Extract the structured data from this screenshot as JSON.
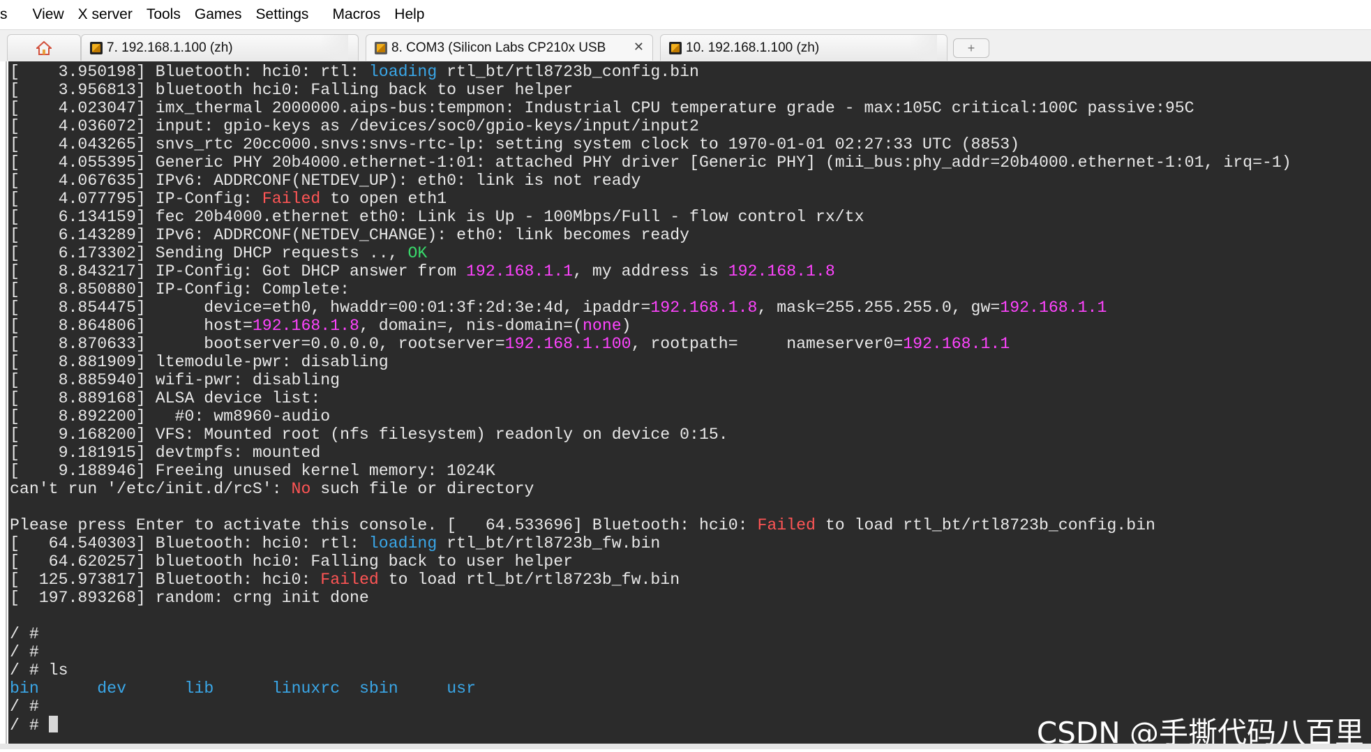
{
  "menu": {
    "items": [
      "s",
      "View",
      "X server",
      "Tools",
      "Games",
      "Settings",
      "Macros",
      "Help"
    ]
  },
  "tabs": {
    "home_icon": "home-icon",
    "items": [
      {
        "label": "7. 192.168.1.100 (zh)",
        "icon": "terminal-icon"
      },
      {
        "label": "8. COM3  (Silicon Labs CP210x USB",
        "icon": "serial-icon",
        "close": "✕"
      },
      {
        "label": "10. 192.168.1.100 (zh)",
        "icon": "terminal-icon"
      }
    ],
    "new_tab_symbol": "+"
  },
  "terminal": {
    "lines": [
      [
        {
          "t": "[    3.950198] Bluetooth: hci0: rtl: "
        },
        {
          "t": "loading",
          "c": "blue"
        },
        {
          "t": " rtl_bt/rtl8723b_config.bin"
        }
      ],
      [
        {
          "t": "[    3.956813] bluetooth hci0: Falling back to user helper"
        }
      ],
      [
        {
          "t": "[    4.023047] imx_thermal 2000000.aips-bus:tempmon: Industrial CPU temperature grade - max:105C critical:100C passive:95C"
        }
      ],
      [
        {
          "t": "[    4.036072] input: gpio-keys as /devices/soc0/gpio-keys/input/input2"
        }
      ],
      [
        {
          "t": "[    4.043265] snvs_rtc 20cc000.snvs:snvs-rtc-lp: setting system clock to 1970-01-01 02:27:33 UTC (8853)"
        }
      ],
      [
        {
          "t": "[    4.055395] Generic PHY 20b4000.ethernet-1:01: attached PHY driver [Generic PHY] (mii_bus:phy_addr=20b4000.ethernet-1:01, irq=-1)"
        }
      ],
      [
        {
          "t": "[    4.067635] IPv6: ADDRCONF(NETDEV_UP): eth0: link is not ready"
        }
      ],
      [
        {
          "t": "[    4.077795] IP-Config: "
        },
        {
          "t": "Failed",
          "c": "red"
        },
        {
          "t": " to open eth1"
        }
      ],
      [
        {
          "t": "[    6.134159] fec 20b4000.ethernet eth0: Link is Up - 100Mbps/Full - flow control rx/tx"
        }
      ],
      [
        {
          "t": "[    6.143289] IPv6: ADDRCONF(NETDEV_CHANGE): eth0: link becomes ready"
        }
      ],
      [
        {
          "t": "[    6.173302] Sending DHCP requests .., "
        },
        {
          "t": "OK",
          "c": "green"
        }
      ],
      [
        {
          "t": "[    8.843217] IP-Config: Got DHCP answer from "
        },
        {
          "t": "192.168.1.1",
          "c": "mag"
        },
        {
          "t": ", my address is "
        },
        {
          "t": "192.168.1.8",
          "c": "mag"
        }
      ],
      [
        {
          "t": "[    8.850880] IP-Config: Complete:"
        }
      ],
      [
        {
          "t": "[    8.854475]      device=eth0, hwaddr=00:01:3f:2d:3e:4d, ipaddr="
        },
        {
          "t": "192.168.1.8",
          "c": "mag"
        },
        {
          "t": ", mask=255.255.255.0, gw="
        },
        {
          "t": "192.168.1.1",
          "c": "mag"
        }
      ],
      [
        {
          "t": "[    8.864806]      host="
        },
        {
          "t": "192.168.1.8",
          "c": "mag"
        },
        {
          "t": ", domain=, nis-domain=("
        },
        {
          "t": "none",
          "c": "mag"
        },
        {
          "t": ")"
        }
      ],
      [
        {
          "t": "[    8.870633]      bootserver=0.0.0.0, rootserver="
        },
        {
          "t": "192.168.1.100",
          "c": "mag"
        },
        {
          "t": ", rootpath=     nameserver0="
        },
        {
          "t": "192.168.1.1",
          "c": "mag"
        }
      ],
      [
        {
          "t": "[    8.881909] ltemodule-pwr: disabling"
        }
      ],
      [
        {
          "t": "[    8.885940] wifi-pwr: disabling"
        }
      ],
      [
        {
          "t": "[    8.889168] ALSA device list:"
        }
      ],
      [
        {
          "t": "[    8.892200]   #0: wm8960-audio"
        }
      ],
      [
        {
          "t": "[    9.168200] VFS: Mounted root (nfs filesystem) readonly on device 0:15."
        }
      ],
      [
        {
          "t": "[    9.181915] devtmpfs: mounted"
        }
      ],
      [
        {
          "t": "[    9.188946] Freeing unused kernel memory: 1024K"
        }
      ],
      [
        {
          "t": "can't run '/etc/init.d/rcS': "
        },
        {
          "t": "No",
          "c": "red"
        },
        {
          "t": " such file or directory"
        }
      ],
      [
        {
          "t": ""
        }
      ],
      [
        {
          "t": "Please press Enter to activate this console. [   64.533696] Bluetooth: hci0: "
        },
        {
          "t": "Failed",
          "c": "red"
        },
        {
          "t": " to load rtl_bt/rtl8723b_config.bin"
        }
      ],
      [
        {
          "t": "[   64.540303] Bluetooth: hci0: rtl: "
        },
        {
          "t": "loading",
          "c": "blue"
        },
        {
          "t": " rtl_bt/rtl8723b_fw.bin"
        }
      ],
      [
        {
          "t": "[   64.620257] bluetooth hci0: Falling back to user helper"
        }
      ],
      [
        {
          "t": "[  125.973817] Bluetooth: hci0: "
        },
        {
          "t": "Failed",
          "c": "red"
        },
        {
          "t": " to load rtl_bt/rtl8723b_fw.bin"
        }
      ],
      [
        {
          "t": "[  197.893268] random: crng init done"
        }
      ],
      [
        {
          "t": ""
        }
      ],
      [
        {
          "t": "/ #"
        }
      ],
      [
        {
          "t": "/ #"
        }
      ],
      [
        {
          "t": "/ # ls"
        }
      ],
      [
        {
          "t": "bin",
          "c": "blue"
        },
        {
          "t": "      "
        },
        {
          "t": "dev",
          "c": "blue"
        },
        {
          "t": "      "
        },
        {
          "t": "lib",
          "c": "blue"
        },
        {
          "t": "      "
        },
        {
          "t": "linuxrc",
          "c": "blue"
        },
        {
          "t": "  "
        },
        {
          "t": "sbin",
          "c": "blue"
        },
        {
          "t": "     "
        },
        {
          "t": "usr",
          "c": "blue"
        }
      ],
      [
        {
          "t": "/ #"
        }
      ],
      [
        {
          "t": "/ # "
        },
        {
          "cursor": true
        }
      ]
    ]
  },
  "watermark": "CSDN @手撕代码八百里",
  "colors": {
    "terminal_bg": "#2b2b2b",
    "terminal_fg": "#e8e8e8",
    "red": "#ff5555",
    "blue": "#3aa7e8",
    "green": "#39d96b",
    "magenta": "#ff44ff"
  }
}
